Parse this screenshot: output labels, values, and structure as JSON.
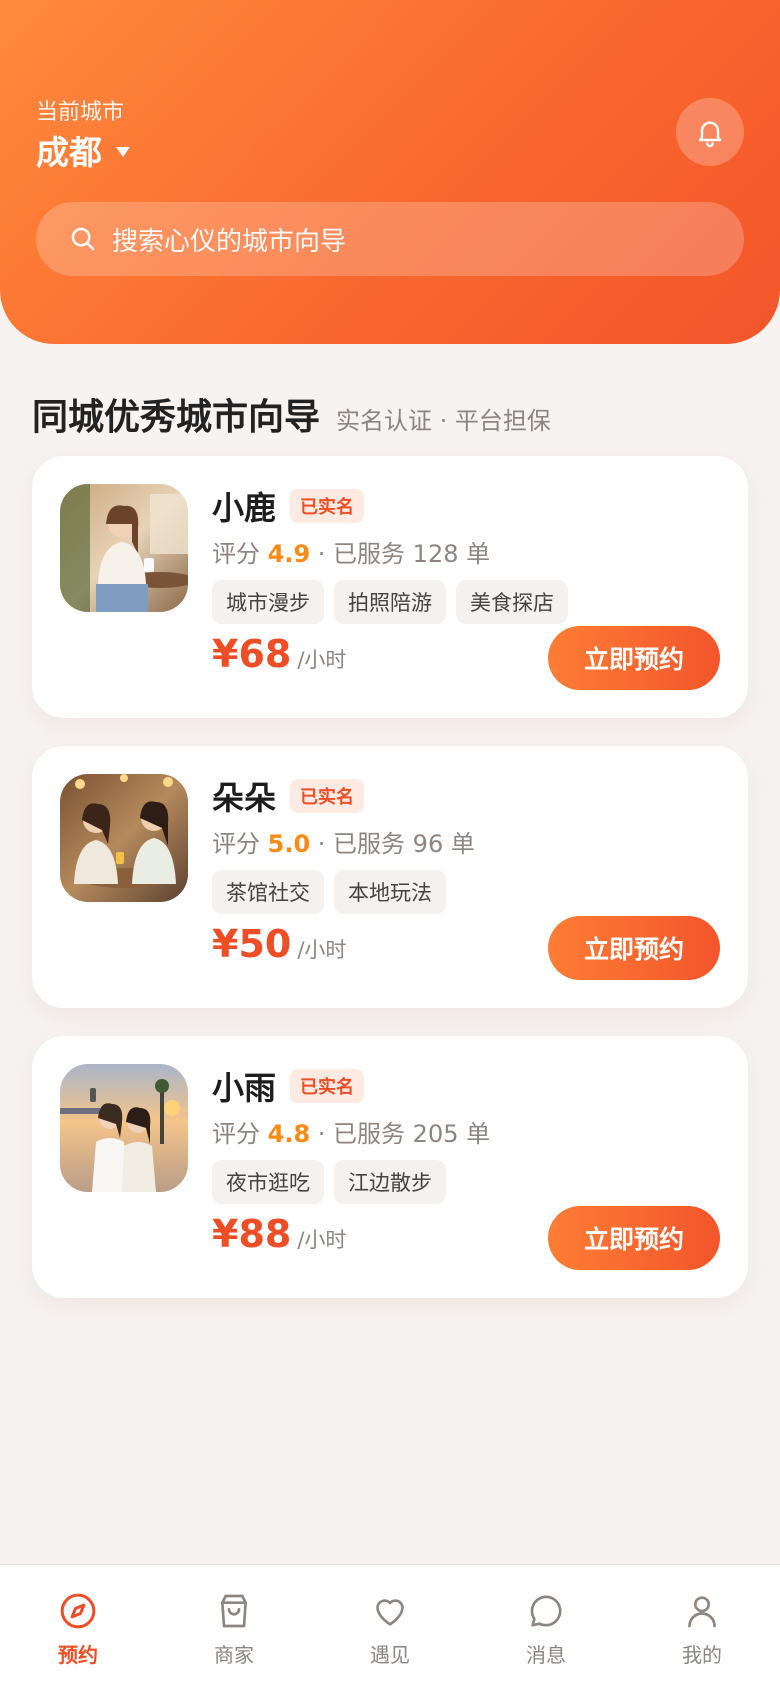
{
  "header": {
    "city_label": "当前城市",
    "city_name": "成都",
    "search_placeholder": "搜索心仪的城市向导"
  },
  "section": {
    "title": "同城优秀城市向导",
    "subtitle": "实名认证 · 平台担保"
  },
  "guides": [
    {
      "name": "小鹿",
      "badge": "已实名",
      "stats_prefix": "评分 ",
      "rating": "4.9",
      "stats_suffix": " · 已服务 128 单",
      "tags": [
        "城市漫步",
        "拍照陪游",
        "美食探店"
      ],
      "price": "¥68",
      "price_unit": "/小时",
      "button": "立即预约"
    },
    {
      "name": "朵朵",
      "badge": "已实名",
      "stats_prefix": "评分 ",
      "rating": "5.0",
      "stats_suffix": " · 已服务 96 单",
      "tags": [
        "茶馆社交",
        "本地玩法"
      ],
      "price": "¥50",
      "price_unit": "/小时",
      "button": "立即预约"
    },
    {
      "name": "小雨",
      "badge": "已实名",
      "stats_prefix": "评分 ",
      "rating": "4.8",
      "stats_suffix": " · 已服务 205 单",
      "tags": [
        "夜市逛吃",
        "江边散步"
      ],
      "price": "¥88",
      "price_unit": "/小时",
      "button": "立即预约"
    }
  ],
  "tabbar": [
    {
      "label": "预约",
      "icon": "compass-icon",
      "active": true
    },
    {
      "label": "商家",
      "icon": "shopping-bag-icon",
      "active": false
    },
    {
      "label": "遇见",
      "icon": "heart-icon",
      "active": false
    },
    {
      "label": "消息",
      "icon": "chat-bubble-icon",
      "active": false
    },
    {
      "label": "我的",
      "icon": "user-icon",
      "active": false
    }
  ],
  "colors": {
    "accent": "#ee4e26",
    "rating": "#fb8a16",
    "header_start": "#ff8a3d",
    "header_end": "#f2552b"
  }
}
